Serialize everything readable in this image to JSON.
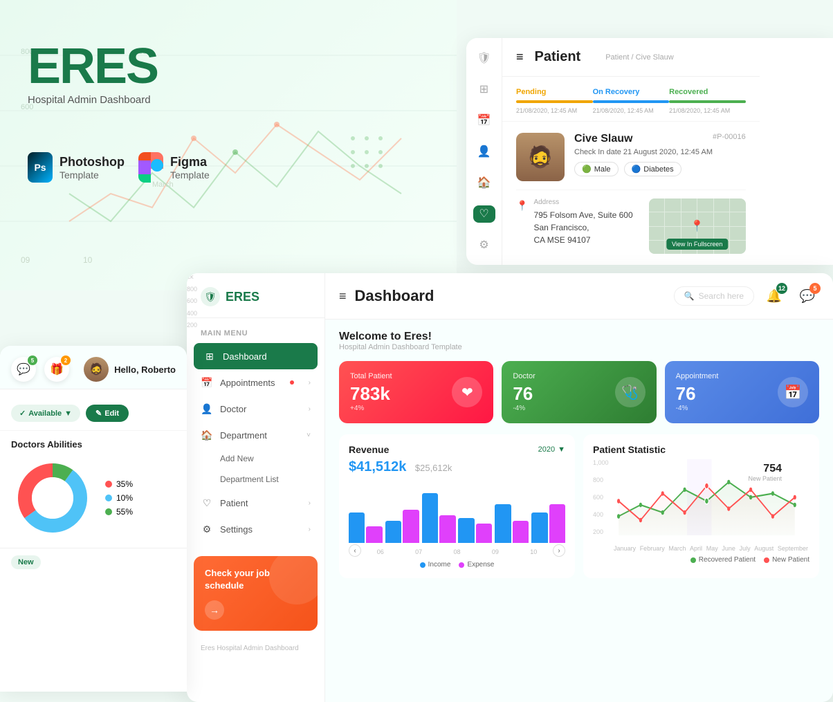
{
  "brand": {
    "logo": "ERES",
    "subtitle": "Hospital Admin Dashboard"
  },
  "templates": [
    {
      "name": "Photoshop",
      "sub": "Template"
    },
    {
      "name": "Figma",
      "sub": "Template"
    }
  ],
  "patient_panel": {
    "title": "Patient",
    "breadcrumb": "Patient / Cive Slauw",
    "timeline": [
      {
        "label": "Pending",
        "status": "pending",
        "time": "21/08/2020, 12:45 AM"
      },
      {
        "label": "On Recovery",
        "status": "recovery",
        "time": "21/08/2020, 12:45 AM"
      },
      {
        "label": "Recovered",
        "status": "recovered",
        "time": "21/08/2020, 12:45 AM"
      }
    ],
    "patient": {
      "name": "Cive Slauw",
      "id": "#P-00016",
      "checkin": "Check In date 21 August 2020, 12:45 AM",
      "gender": "Male",
      "condition": "Diabetes",
      "address_label": "Address",
      "address": "795 Folsom Ave, Suite 600\nSan Francisco,\nCA MSE 94107",
      "map_btn": "View In Fullscreen"
    }
  },
  "sidebar": {
    "logo": "ERES",
    "menu_title": "Main Menu",
    "items": [
      {
        "label": "Dashboard",
        "icon": "⊞",
        "active": true
      },
      {
        "label": "Appointments",
        "icon": "📅",
        "has_dot": true,
        "has_arrow": true
      },
      {
        "label": "Doctor",
        "icon": "👤",
        "has_arrow": true
      },
      {
        "label": "Department",
        "icon": "🏠",
        "has_arrow": true
      },
      {
        "label": "Patient",
        "icon": "♡",
        "has_arrow": true
      },
      {
        "label": "Settings",
        "icon": "⚙",
        "has_arrow": true
      }
    ],
    "sub_items": [
      "Add New",
      "Department List"
    ],
    "promo": {
      "title": "Check your job schedule",
      "arrow": "→"
    },
    "footer": "Eres Hospital Admin Dashboard"
  },
  "dashboard": {
    "page_title": "Dashboard",
    "welcome_title": "Welcome to Eres!",
    "welcome_sub": "Hospital Admin Dashboard Template",
    "search_placeholder": "Search here",
    "notification_count": "12",
    "message_count": "5",
    "stats": [
      {
        "label": "Total Patient",
        "value": "783k",
        "change": "+4%",
        "icon": "❤",
        "color": "red"
      },
      {
        "label": "Doctor",
        "value": "76",
        "change": "-4%",
        "icon": "🩺",
        "color": "green"
      },
      {
        "label": "Appointment",
        "value": "76",
        "change": "-4%",
        "icon": "📅",
        "color": "blue"
      }
    ],
    "revenue_chart": {
      "title": "Revenue",
      "period": "2020",
      "amount_main": "$41,512k",
      "amount_sub": "$25,612k",
      "y_labels": [
        "1k",
        "800",
        "600",
        "400",
        "200"
      ],
      "x_labels": [
        "06",
        "07",
        "08",
        "09",
        "10"
      ],
      "bars": [
        {
          "income": 55,
          "expense": 30
        },
        {
          "income": 40,
          "expense": 60
        },
        {
          "income": 90,
          "expense": 50
        },
        {
          "income": 45,
          "expense": 35
        },
        {
          "income": 70,
          "expense": 40
        },
        {
          "income": 55,
          "expense": 70
        }
      ],
      "legend": [
        {
          "label": "Income",
          "type": "income"
        },
        {
          "label": "Expense",
          "type": "expense"
        }
      ]
    },
    "patient_statistic": {
      "title": "Patient Statistic",
      "highlight_value": "754",
      "highlight_label": "New Patient",
      "y_labels": [
        "1,000",
        "800",
        "600",
        "400",
        "200"
      ],
      "x_labels": [
        "January",
        "February",
        "March",
        "April",
        "May",
        "June",
        "July",
        "August",
        "September"
      ],
      "legend": [
        {
          "label": "Recovered Patient",
          "type": "recovered"
        },
        {
          "label": "New Patient",
          "type": "new"
        }
      ]
    }
  },
  "left_panel": {
    "user_greeting": "Hello, Roberto",
    "notif_count1": "5",
    "notif_count2": "2",
    "available_btn": "Available",
    "edit_btn": "Edit",
    "abilities_title": "Doctors Abilities",
    "donut_segments": [
      {
        "label": "35%",
        "pct": 35,
        "color": "#ff5252"
      },
      {
        "label": "55%",
        "pct": 55,
        "color": "#4FC3F7"
      },
      {
        "label": "10%",
        "pct": 10,
        "color": "#4CAF50"
      }
    ],
    "new_badge_text": "New",
    "new_badge_label": ""
  }
}
